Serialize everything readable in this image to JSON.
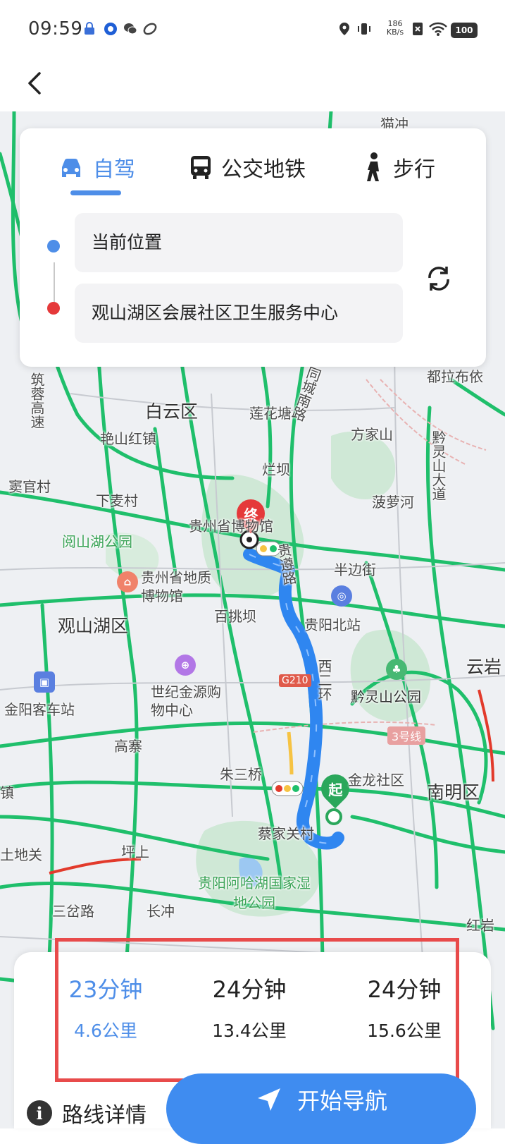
{
  "status_bar": {
    "time": "09:59",
    "speed_value": "186",
    "speed_unit": "KB/s",
    "battery": "100"
  },
  "route_panel": {
    "tabs": [
      {
        "label": "自驾",
        "icon": "car-icon",
        "active": true
      },
      {
        "label": "公交地铁",
        "icon": "bus-icon",
        "active": false
      },
      {
        "label": "步行",
        "icon": "walk-icon",
        "active": false
      }
    ],
    "origin": "当前位置",
    "destination": "观山湖区会展社区卫生服务中心"
  },
  "map": {
    "districts": [
      "白云区",
      "观山湖区",
      "南明区",
      "云岩"
    ],
    "roads": [
      "筑蓉高速",
      "同城南路",
      "贵遵路",
      "西二环",
      "G210",
      "黔灵山大道",
      "都拉布依",
      "猫冲"
    ],
    "places": [
      "艳山红镇",
      "莲花塘",
      "方家山",
      "窦官村",
      "下麦村",
      "烂坝",
      "菠萝河",
      "半边街",
      "百挑坝",
      "贵阳北站",
      "金阳客车站",
      "高寨",
      "朱三桥",
      "金龙社区",
      "蔡家关村",
      "坪上",
      "三岔路",
      "长冲",
      "土地关",
      "牛镇",
      "红岩",
      "贵州省博物馆",
      "贵州省地质博物馆",
      "世纪金源购物中心"
    ],
    "parks": [
      "阅山湖公园",
      "黔灵山公园",
      "贵阳阿哈湖国家湿地公园"
    ],
    "metro_line": "3号线",
    "start_marker": "起",
    "end_marker": "终"
  },
  "routes": [
    {
      "time": "23分钟",
      "distance": "4.6公里",
      "selected": true
    },
    {
      "time": "24分钟",
      "distance": "13.4公里",
      "selected": false
    },
    {
      "time": "24分钟",
      "distance": "15.6公里",
      "selected": false
    }
  ],
  "actions": {
    "details": "路线详情",
    "navigate": "开始导航"
  },
  "colors": {
    "accent": "#4e8ee8",
    "route_line": "#2f86f0",
    "traffic_green": "#1fbf6b",
    "highlight": "#e84b4b",
    "start": "#2aa75b",
    "end": "#e5393a"
  }
}
